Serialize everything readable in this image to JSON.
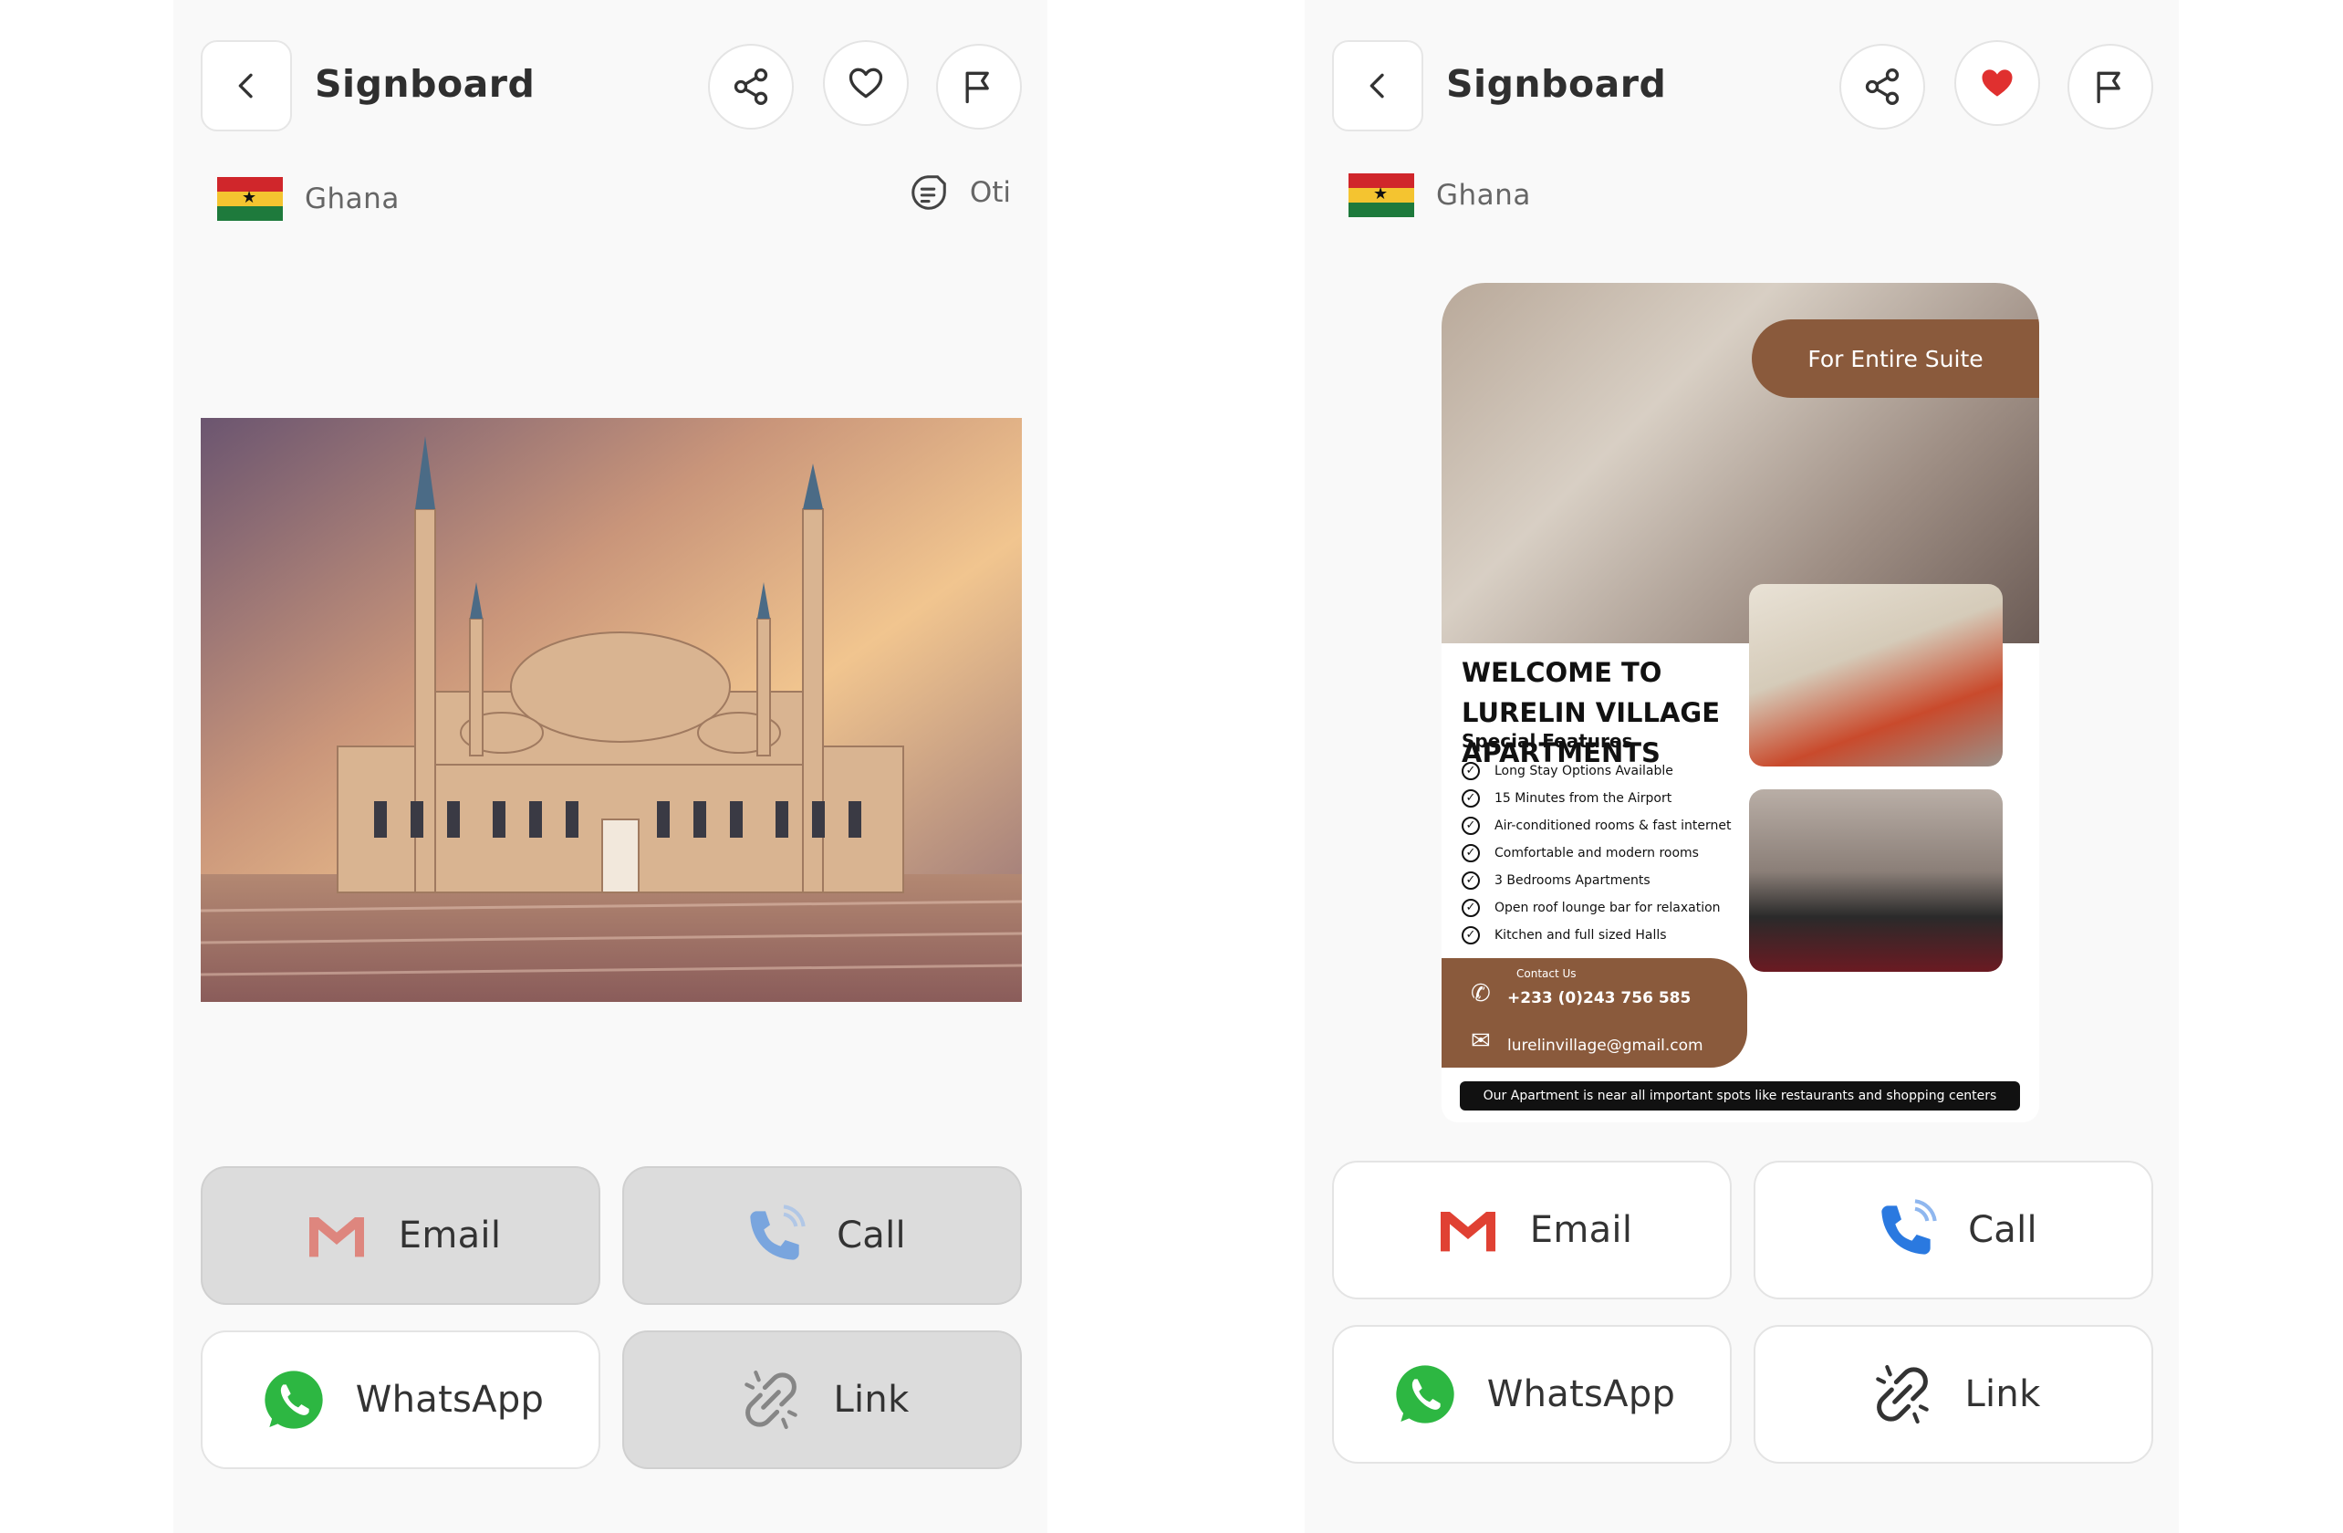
{
  "screens": [
    {
      "title": "Signboard",
      "country": "Ghana",
      "language": "Oti",
      "favorited": false,
      "image_desc": "mosque",
      "buttons": {
        "email": {
          "label": "Email",
          "disabled": true
        },
        "call": {
          "label": "Call",
          "disabled": true
        },
        "whatsapp": {
          "label": "WhatsApp",
          "disabled": false
        },
        "link": {
          "label": "Link",
          "disabled": true
        }
      }
    },
    {
      "title": "Signboard",
      "country": "Ghana",
      "favorited": true,
      "flyer": {
        "badge": "For Entire Suite",
        "heading": "WELCOME TO LURELIN VILLAGE APARTMENTS",
        "subheading": "Special Features",
        "features": [
          "Long Stay Options Available",
          "15 Minutes from the Airport",
          "Air-conditioned rooms & fast internet",
          "Comfortable and modern rooms",
          "3 Bedrooms Apartments",
          "Open roof lounge bar for relaxation",
          "Kitchen and full sized Halls"
        ],
        "contact_label": "Contact Us",
        "phone": "+233 (0)243 756 585",
        "email": "lurelinvillage@gmail.com",
        "footer": "Our Apartment is near all important spots like restaurants and shopping centers"
      },
      "buttons": {
        "email": {
          "label": "Email",
          "disabled": false
        },
        "call": {
          "label": "Call",
          "disabled": false
        },
        "whatsapp": {
          "label": "WhatsApp",
          "disabled": false
        },
        "link": {
          "label": "Link",
          "disabled": false
        }
      }
    }
  ],
  "colors": {
    "background": "#f9f9f9",
    "disabled_button": "#dcdcdc",
    "heart_active": "#e0302f",
    "brown_accent": "#8a5a3c"
  }
}
